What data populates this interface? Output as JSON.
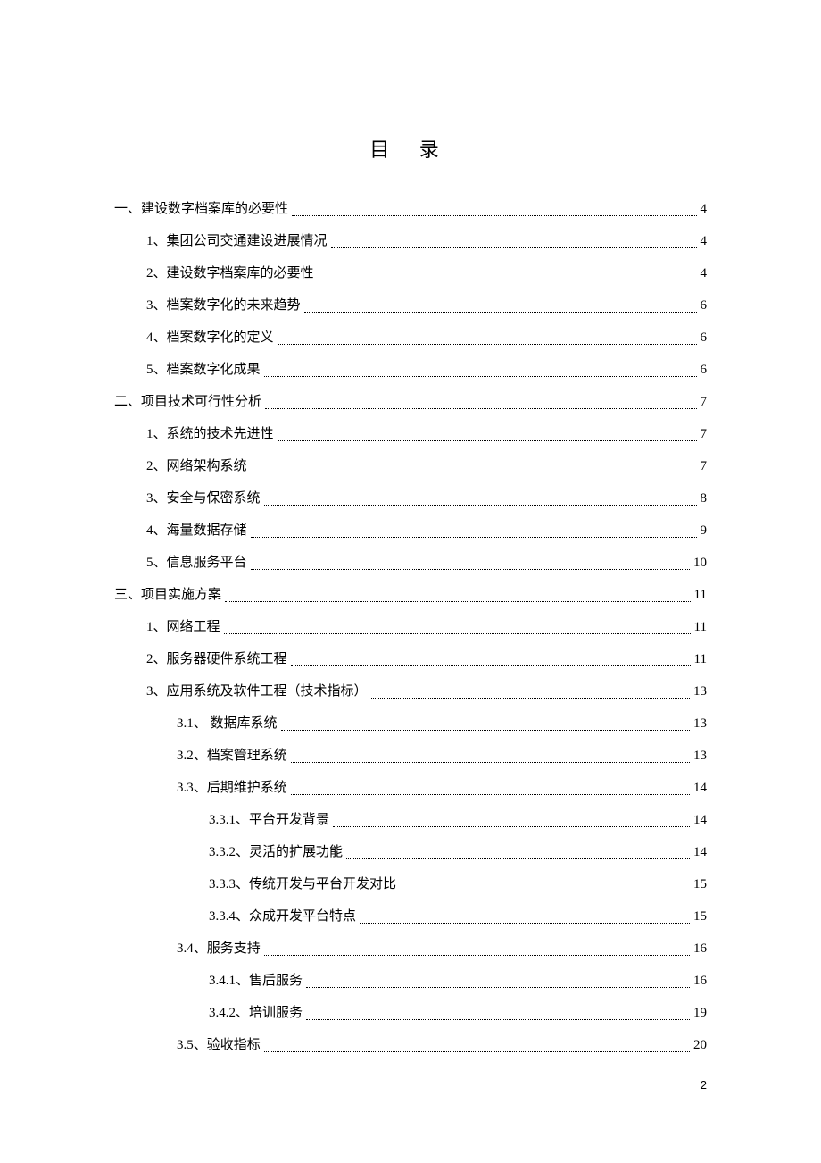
{
  "title": "目 录",
  "page_number": "2",
  "entries": [
    {
      "level": 0,
      "text": "一、建设数字档案库的必要性",
      "page": "4"
    },
    {
      "level": 1,
      "text": "1、集团公司交通建设进展情况",
      "page": "4"
    },
    {
      "level": 1,
      "text": "2、建设数字档案库的必要性",
      "page": "4"
    },
    {
      "level": 1,
      "text": "3、档案数字化的未来趋势",
      "page": "6"
    },
    {
      "level": 1,
      "text": "4、档案数字化的定义",
      "page": "6"
    },
    {
      "level": 1,
      "text": "5、档案数字化成果",
      "page": "6"
    },
    {
      "level": 0,
      "text": "二、项目技术可行性分析",
      "page": "7"
    },
    {
      "level": 1,
      "text": "1、系统的技术先进性",
      "page": "7"
    },
    {
      "level": 1,
      "text": "2、网络架构系统",
      "page": "7"
    },
    {
      "level": 1,
      "text": "3、安全与保密系统",
      "page": "8"
    },
    {
      "level": 1,
      "text": "4、海量数据存储",
      "page": "9"
    },
    {
      "level": 1,
      "text": "5、信息服务平台",
      "page": "10"
    },
    {
      "level": 0,
      "text": "三、项目实施方案",
      "page": "11"
    },
    {
      "level": 1,
      "text": "1、网络工程",
      "page": "11"
    },
    {
      "level": 1,
      "text": "2、服务器硬件系统工程",
      "page": "11"
    },
    {
      "level": 1,
      "text": "3、应用系统及软件工程（技术指标）",
      "page": "13"
    },
    {
      "level": 2,
      "text": "3.1、 数据库系统",
      "page": "13"
    },
    {
      "level": 2,
      "text": "3.2、档案管理系统",
      "page": "13"
    },
    {
      "level": 2,
      "text": "3.3、后期维护系统",
      "page": "14"
    },
    {
      "level": 3,
      "text": "3.3.1、平台开发背景",
      "page": "14"
    },
    {
      "level": 3,
      "text": "3.3.2、灵活的扩展功能",
      "page": "14"
    },
    {
      "level": 3,
      "text": "3.3.3、传统开发与平台开发对比",
      "page": "15"
    },
    {
      "level": 3,
      "text": "3.3.4、众成开发平台特点",
      "page": "15"
    },
    {
      "level": 2,
      "text": "3.4、服务支持",
      "page": "16"
    },
    {
      "level": 3,
      "text": "3.4.1、售后服务",
      "page": "16"
    },
    {
      "level": 3,
      "text": "3.4.2、培训服务",
      "page": "19"
    },
    {
      "level": 2,
      "text": "3.5、验收指标",
      "page": "20"
    }
  ]
}
